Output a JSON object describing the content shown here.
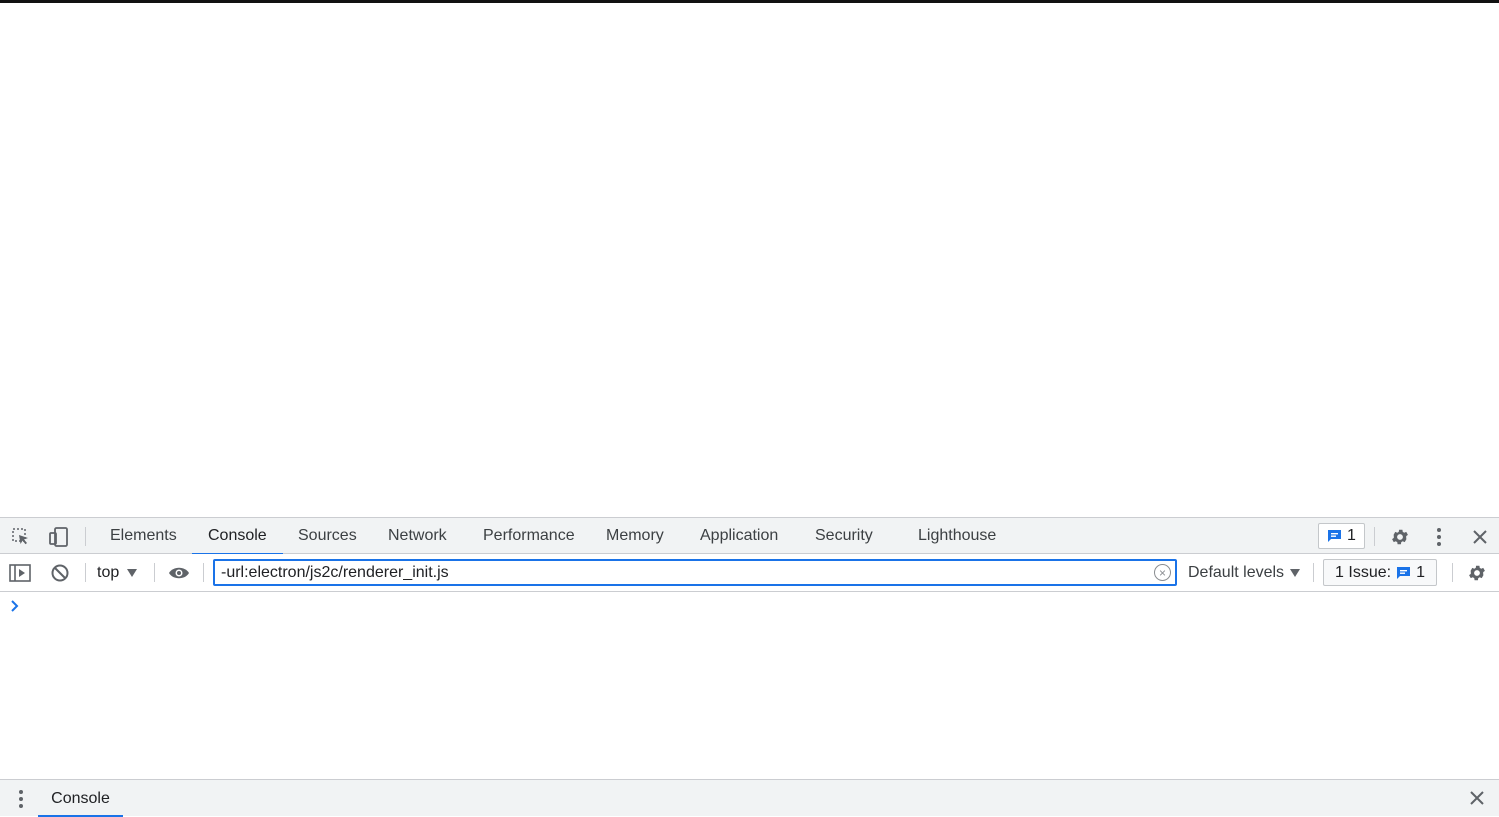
{
  "devtools": {
    "tabs": [
      {
        "label": "Elements"
      },
      {
        "label": "Console"
      },
      {
        "label": "Sources"
      },
      {
        "label": "Network"
      },
      {
        "label": "Performance"
      },
      {
        "label": "Memory"
      },
      {
        "label": "Application"
      },
      {
        "label": "Security"
      },
      {
        "label": "Lighthouse"
      }
    ],
    "active_tab": "Console",
    "message_count": "1"
  },
  "console_toolbar": {
    "context": "top",
    "filter_value": "-url:electron/js2c/renderer_init.js",
    "levels_label": "Default levels",
    "issues_label": "1 Issue:",
    "issues_count": "1"
  },
  "drawer": {
    "tab_label": "Console"
  },
  "colors": {
    "accent": "#1a73e8",
    "toolbar_bg": "#f1f3f4",
    "border": "#cbcdd1"
  }
}
